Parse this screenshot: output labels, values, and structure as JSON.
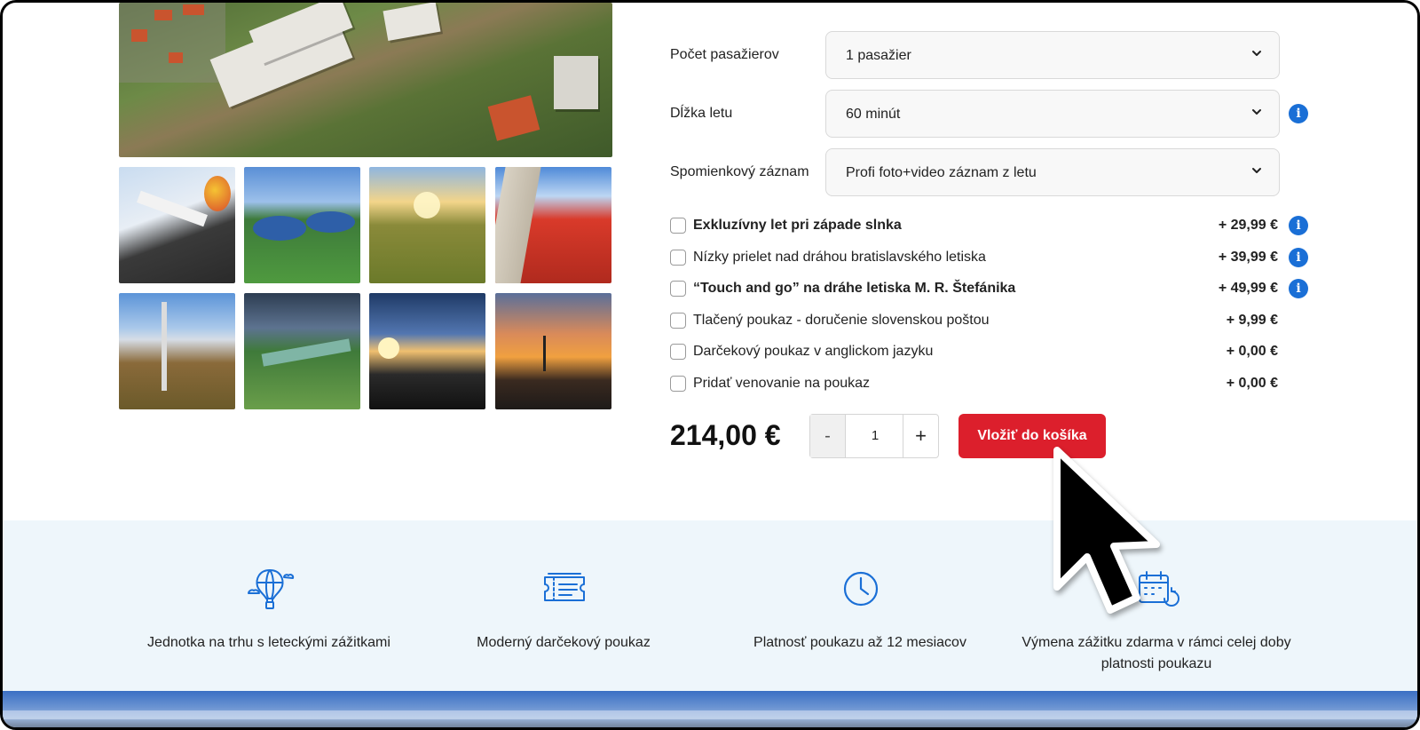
{
  "form": {
    "passengers": {
      "label": "Počet pasažierov",
      "value": "1 pasažier"
    },
    "duration": {
      "label": "Dĺžka letu",
      "value": "60 minút"
    },
    "record": {
      "label": "Spomienkový záznam",
      "value": "Profi foto+video záznam z letu"
    }
  },
  "options": [
    {
      "label": "Exkluzívny let pri západe slnka",
      "price": "+ 29,99 €",
      "bold": true,
      "info": true
    },
    {
      "label": "Nízky prielet nad dráhou bratislavského letiska",
      "price": "+ 39,99 €",
      "bold": false,
      "info": true
    },
    {
      "label": "“Touch and go” na dráhe letiska M. R. Štefánika",
      "price": "+ 49,99 €",
      "bold": true,
      "info": true
    },
    {
      "label": "Tlačený poukaz - doručenie slovenskou poštou",
      "price": "+ 9,99 €",
      "bold": false,
      "info": false
    },
    {
      "label": "Darčekový poukaz v anglickom jazyku",
      "price": "+ 0,00 €",
      "bold": false,
      "info": false
    },
    {
      "label": "Pridať venovanie na poukaz",
      "price": "+ 0,00 €",
      "bold": false,
      "info": false
    }
  ],
  "purchase": {
    "total": "214,00 €",
    "qty_minus": "-",
    "qty_value": "1",
    "qty_plus": "+",
    "cart_button": "Vložiť do košíka"
  },
  "features": [
    {
      "icon": "hot-air-balloon-icon",
      "text": "Jednotka na trhu s leteckými zážitkami"
    },
    {
      "icon": "ticket-icon",
      "text": "Moderný darčekový poukaz"
    },
    {
      "icon": "clock-icon",
      "text": "Platnosť poukazu až 12 mesiacov"
    },
    {
      "icon": "calendar-refresh-icon",
      "text": "Výmena zážitku zdarma v rámci celej doby platnosti poukazu"
    }
  ],
  "colors": {
    "accent_red": "#dc1f2c",
    "info_blue": "#1a6fd6",
    "band_bg": "#eef6fb",
    "icon_blue": "#1a6fd6"
  }
}
